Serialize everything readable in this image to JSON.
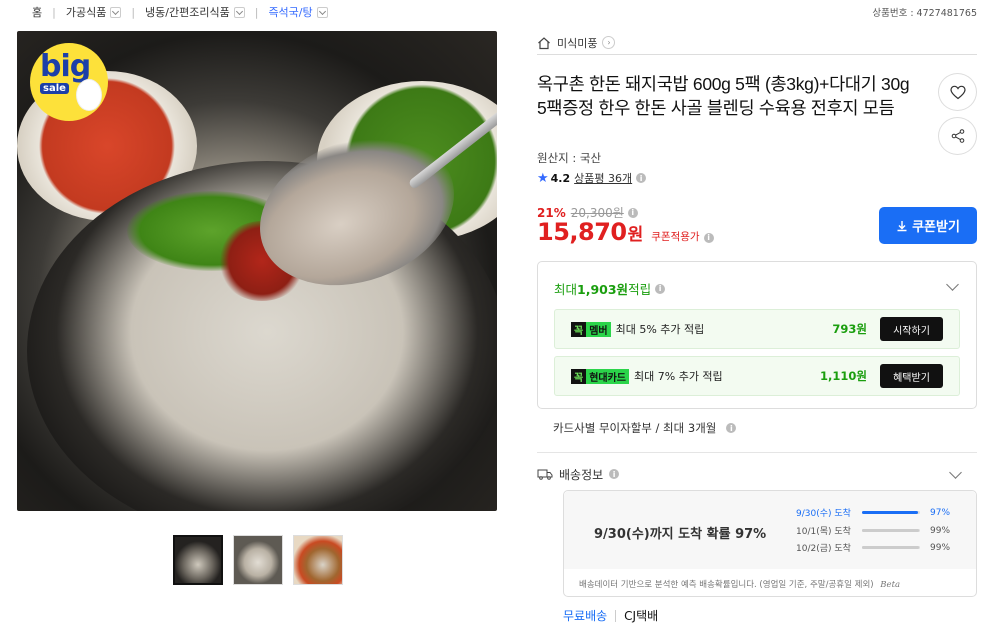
{
  "breadcrumb": [
    {
      "label": "홈"
    },
    {
      "label": "가공식품"
    },
    {
      "label": "냉동/간편조리식품"
    },
    {
      "label": "즉석국/탕"
    }
  ],
  "product_no": "상품번호 : 4727481765",
  "badge": {
    "big": "big",
    "sale": "sale"
  },
  "brand": {
    "name": "미식미풍"
  },
  "product": {
    "title": "옥구촌 한돈 돼지국밥 600g 5팩 (총3kg)+다대기 30g 5팩증정 한우 한돈 사골 블렌딩 수육용 전후지 모듬",
    "origin": "원산지 : 국산",
    "rating": "4.2",
    "reviews": "상품평 36개"
  },
  "price": {
    "discount_pct": "21%",
    "original": "20,300원",
    "sale": "15,870",
    "won": "원",
    "coupon_text": "쿠폰적용가",
    "coupon_button": "쿠폰받기"
  },
  "points": {
    "title_prefix": "최대 ",
    "title_amount": "1,903원",
    "title_suffix": " 적립",
    "rows": [
      {
        "kkok": "꼭",
        "name": "멤버",
        "desc": "최대 5% 추가 적립",
        "amount": "793원",
        "action": "시작하기"
      },
      {
        "kkok": "꼭",
        "name": "현대카드",
        "desc": "최대 7% 추가 적립",
        "amount": "1,110원",
        "action": "혜택받기"
      }
    ]
  },
  "installment": "카드사별 무이자할부 / 최대 3개월",
  "shipping": {
    "label": "배송정보",
    "headline": "9/30(수)까지 도착 확률 97%",
    "probabilities": [
      {
        "label": "9/30(수) 도착",
        "value": "97%",
        "fraction": 0.97
      },
      {
        "label": "10/1(목) 도착",
        "value": "99%",
        "fraction": 0.99
      },
      {
        "label": "10/2(금) 도착",
        "value": "99%",
        "fraction": 0.99
      }
    ],
    "note": "배송데이터 기반으로 분석한 예측 배송확률입니다. (영업일 기준, 주말/공휴일 제외)",
    "beta": "Beta",
    "free": "무료배송",
    "carrier": "CJ택배"
  },
  "colors": {
    "accent_blue": "#1a6ef5",
    "price_red": "#e02020",
    "points_green": "#1a9e0e"
  }
}
